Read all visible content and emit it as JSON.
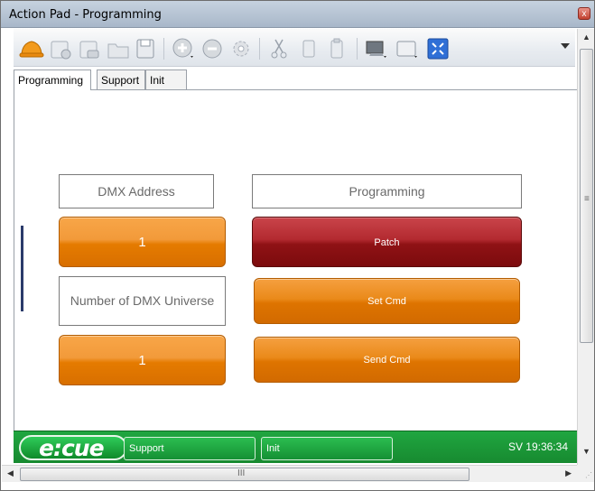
{
  "window": {
    "title": "Action Pad - Programming",
    "close_glyph": "x"
  },
  "toolbar": {
    "icons": [
      "hardhat-icon",
      "new-page-icon",
      "open-page-icon",
      "folder-icon",
      "save-icon",
      "add-icon",
      "remove-icon",
      "settings-gear-icon",
      "cut-icon",
      "copy-icon",
      "paste-icon",
      "monitor-icon",
      "window-icon",
      "fit-screen-icon"
    ],
    "overflow_glyph": "▾"
  },
  "tabs": [
    {
      "label": "Programming",
      "active": true
    },
    {
      "label": "Support",
      "active": false
    },
    {
      "label": "Init",
      "active": false
    }
  ],
  "pad": {
    "dmx_address_label": "DMX Address",
    "dmx_address_value": "1",
    "universe_label": "Number of DMX Universe",
    "universe_value": "1",
    "programming_label": "Programming",
    "patch_label": "Patch",
    "set_cmd_label": "Set Cmd",
    "send_cmd_label": "Send Cmd"
  },
  "status": {
    "logo_text": "e:cue",
    "support_label": "Support",
    "init_label": "Init",
    "clock": "SV 19:36:34"
  },
  "scroll": {
    "up_glyph": "▲",
    "down_glyph": "▼",
    "left_glyph": "◀",
    "right_glyph": "▶",
    "h_grip": "III",
    "v_grip": "≡",
    "corner_grip": "⋰"
  },
  "colors": {
    "accent_orange": "#e57b00",
    "accent_red": "#8f1215",
    "status_green": "#178a30"
  }
}
